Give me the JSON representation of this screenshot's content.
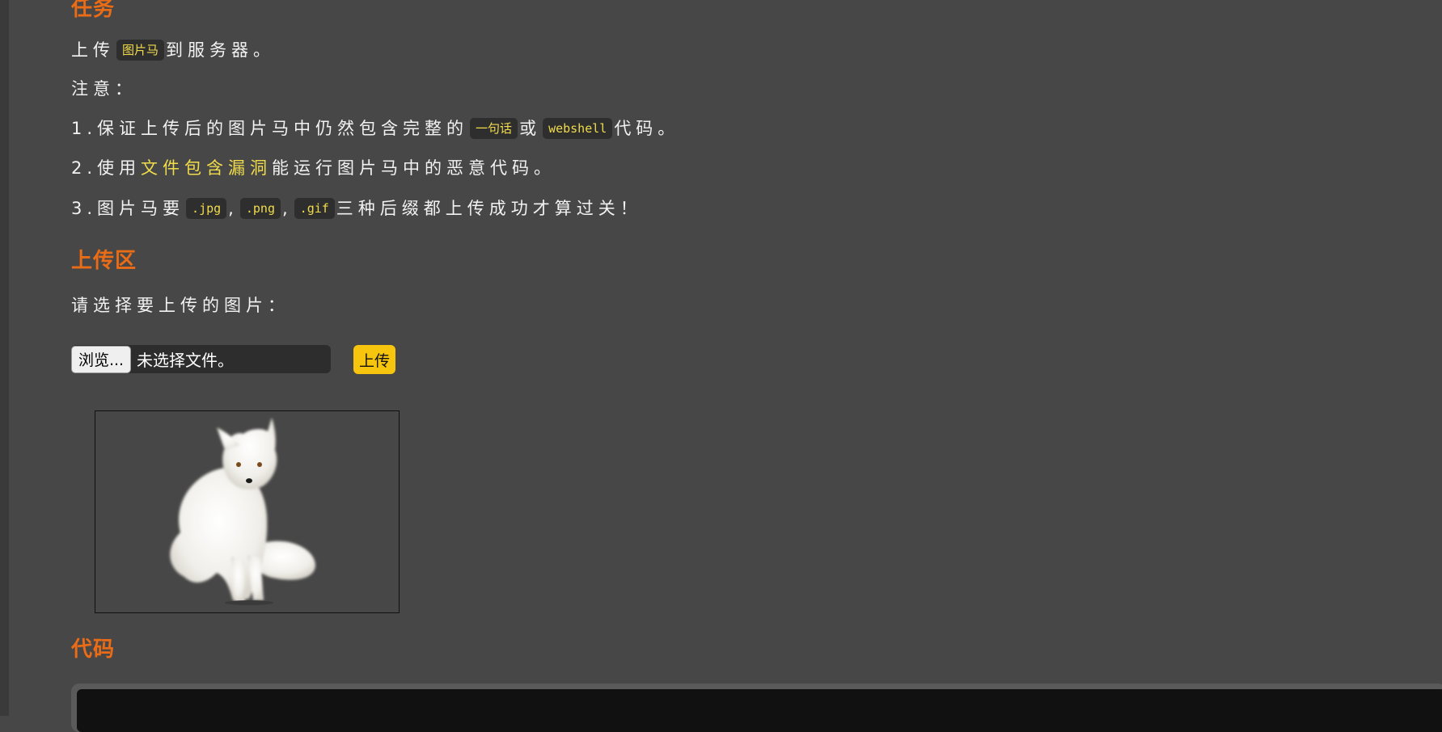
{
  "sections": {
    "task": {
      "title": "任务"
    },
    "upload": {
      "title": "上传区"
    },
    "code": {
      "title": "代码"
    }
  },
  "task": {
    "line1": {
      "before": "上传",
      "code": "图片马",
      "after": "到服务器。"
    },
    "note_label": "注意：",
    "item1": {
      "before": "1.保证上传后的图片马中仍然包含完整的",
      "code1": "一句话",
      "mid": "或",
      "code2": "webshell",
      "after": "代码。"
    },
    "item2": {
      "before": "2.使用",
      "highlight": "文件包含漏洞",
      "after": "能运行图片马中的恶意代码。"
    },
    "item3": {
      "before": "3.图片马要",
      "code1": ".jpg",
      "sep1": ",",
      "code2": ".png",
      "sep2": ",",
      "code3": ".gif",
      "after": "三种后缀都上传成功才算过关！"
    }
  },
  "upload_area": {
    "prompt": "请选择要上传的图片：",
    "browse_label": "浏览...",
    "file_status": "未选择文件。",
    "submit_label": "上传"
  },
  "preview_image": {
    "subject": "white arctic fox sitting"
  },
  "colors": {
    "background": "#474747",
    "heading": "#ea6c17",
    "code_text": "#f1dc4c",
    "code_bg": "#2e2e2e",
    "upload_button": "#f7c50e"
  }
}
